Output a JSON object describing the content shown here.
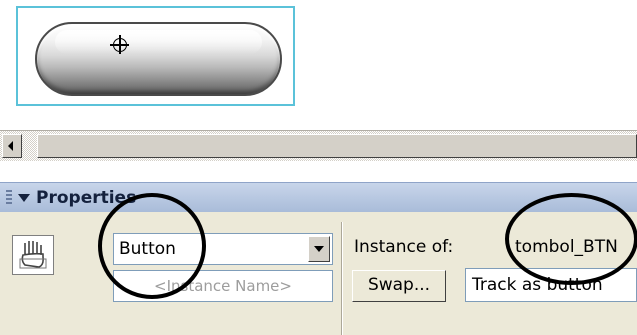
{
  "stage": {
    "button_symbol": "pill-shaped chrome button",
    "registration_mark": "crosshair-icon"
  },
  "scrollbar": {
    "left_arrow_icon": "arrow-left-icon"
  },
  "properties": {
    "title": "Properties",
    "symbol_icon": "button-symbol-icon",
    "behavior_value": "Button",
    "instance_name_placeholder": "<Instance Name>",
    "instance_of_label": "Instance of:",
    "symbol_name": "tombol_BTN",
    "swap_label": "Swap...",
    "tracking_value": "Track as button"
  },
  "colors": {
    "selection_outline": "#5bc2d9",
    "panel_header": "#b9c9e2",
    "panel_body": "#ece9d8"
  }
}
